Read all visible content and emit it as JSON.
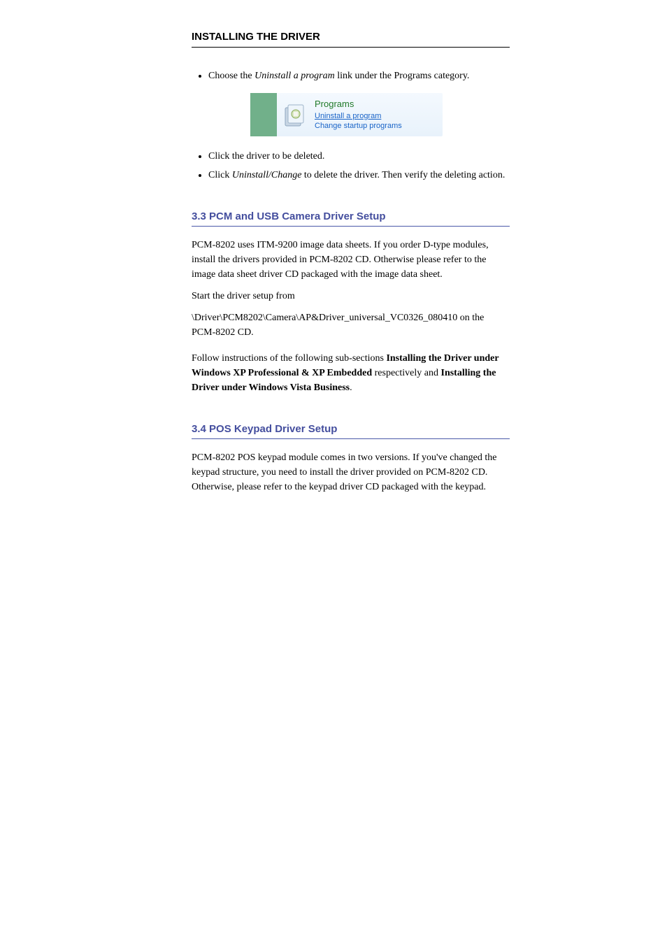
{
  "section": {
    "title": "INSTALLING THE DRIVER"
  },
  "bullets": {
    "b1_prefix": "Choose the ",
    "b1_em": "Uninstall a program",
    "b1_suffix": " link under the Programs category.",
    "b2": "Click the driver to be deleted.",
    "b3_prefix": "Click ",
    "b3_em": "Uninstall/Change",
    "b3_suffix": " to delete the driver. Then verify the deleting action."
  },
  "cp_item": {
    "heading": "Programs",
    "link": "Uninstall a program",
    "sub": "Change startup programs"
  },
  "section2": {
    "heading": "3.3 PCM and USB Camera Driver Setup",
    "p1": "PCM-8202 uses ITM-9200 image data sheets. If you order D-type modules, install the drivers provided in PCM-8202 CD. Otherwise please refer to the image data sheet driver CD packaged with the image data sheet.",
    "p2": "Start the driver setup from",
    "path": "\\Driver\\PCM8202\\Camera\\AP&Driver_universal_VC0326_080410 on the PCM-8202 CD.",
    "p3_prefix": "Follow instructions of the following sub-sections ",
    "p3_em1": "Installing the Driver under Windows XP Professional & XP Embedded",
    "p3_mid": " respectively and ",
    "p3_em2": "Installing the Driver under Windows Vista Business",
    "p3_suffix": "."
  },
  "section3": {
    "heading": "3.4 POS Keypad Driver Setup",
    "p1": "PCM-8202 POS keypad module comes in two versions. If you've changed the keypad structure, you need to install the driver provided on PCM-8202 CD. Otherwise, please refer to the keypad driver CD packaged with the keypad."
  }
}
